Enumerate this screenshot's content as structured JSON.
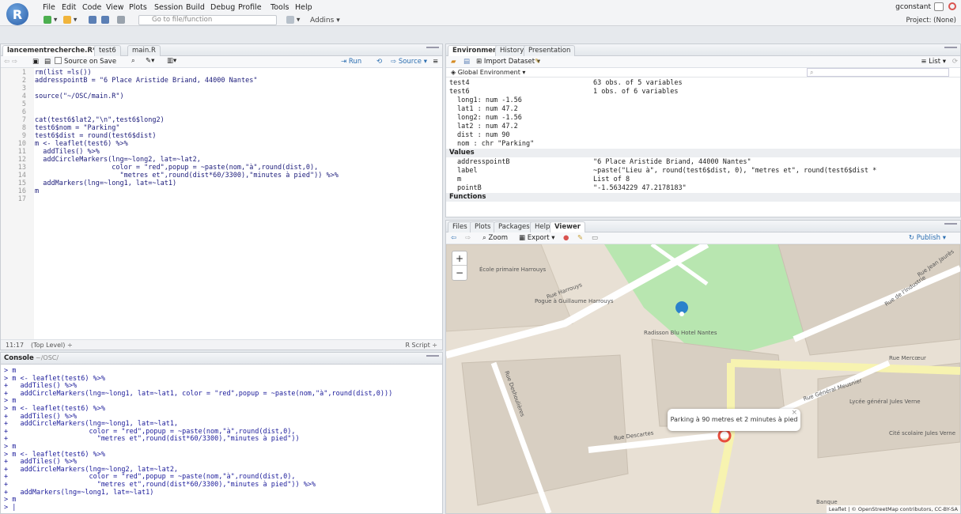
{
  "app": {
    "logo": "R",
    "menu": [
      "File",
      "Edit",
      "Code",
      "View",
      "Plots",
      "Session",
      "Build",
      "Debug",
      "Profile",
      "Tools",
      "Help"
    ],
    "user": "gconstant",
    "goto_placeholder": "Go to file/function",
    "addins": "Addins",
    "project": "Project: (None)"
  },
  "source": {
    "tabs": [
      {
        "label": "lancementrecherche.R*",
        "active": true
      },
      {
        "label": "test6",
        "active": false
      },
      {
        "label": "main.R",
        "active": false
      }
    ],
    "source_on_save": "Source on Save",
    "run": "Run",
    "source_btn": "Source",
    "lines": [
      "rm(list =ls())",
      "addresspointB = \"6 Place Aristide Briand, 44000 Nantes\"",
      "",
      "source(\"~/OSC/main.R\")",
      "",
      "",
      "cat(test6$lat2,\"\\n\",test6$long2)",
      "test6$nom = \"Parking\"",
      "test6$dist = round(test6$dist)",
      "m <- leaflet(test6) %>%",
      "  addTiles() %>%",
      "  addCircleMarkers(lng=~long2, lat=~lat2,",
      "                   color = \"red\",popup = ~paste(nom,\"à\",round(dist,0),",
      "                     \"metres et\",round(dist*60/3300),\"minutes à pied\")) %>%",
      "  addMarkers(lng=~long1, lat=~lat1)",
      "m",
      ""
    ],
    "status_pos": "11:17",
    "status_level": "(Top Level) ÷",
    "status_type": "R Script ÷"
  },
  "console": {
    "title": "Console",
    "path": "~/OSC/",
    "lines": [
      "> m",
      "> m <- leaflet(test6) %>%",
      "+   addTiles() %>%",
      "+   addCircleMarkers(lng=~long1, lat=~lat1, color = \"red\",popup = ~paste(nom,\"à\",round(dist,0)))",
      "> m",
      "> m <- leaflet(test6) %>%",
      "+   addTiles() %>%",
      "+   addCircleMarkers(lng=~long1, lat=~lat1,",
      "+                    color = \"red\",popup = ~paste(nom,\"à\",round(dist,0),",
      "+                      \"metres et\",round(dist*60/3300),\"minutes à pied\"))",
      "> m",
      "> m <- leaflet(test6) %>%",
      "+   addTiles() %>%",
      "+   addCircleMarkers(lng=~long2, lat=~lat2,",
      "+                    color = \"red\",popup = ~paste(nom,\"à\",round(dist,0),",
      "+                      \"metres et\",round(dist*60/3300),\"minutes à pied\")) %>%",
      "+   addMarkers(lng=~long1, lat=~lat1)",
      "> m",
      "> |"
    ]
  },
  "environment": {
    "tabs": [
      "Environment",
      "History",
      "Presentation"
    ],
    "import": "Import Dataset",
    "list": "List",
    "scope": "Global Environment",
    "rows": [
      {
        "name": "test4",
        "value": "63 obs. of 5 variables",
        "kind": "data"
      },
      {
        "name": "test6",
        "value": "1 obs. of 6 variables",
        "kind": "data"
      },
      {
        "name": "  long1: num -1.56",
        "value": "",
        "kind": "sub"
      },
      {
        "name": "  lat1 : num 47.2",
        "value": "",
        "kind": "sub"
      },
      {
        "name": "  long2: num -1.56",
        "value": "",
        "kind": "sub"
      },
      {
        "name": "  lat2 : num 47.2",
        "value": "",
        "kind": "sub"
      },
      {
        "name": "  dist : num 90",
        "value": "",
        "kind": "sub"
      },
      {
        "name": "  nom : chr \"Parking\"",
        "value": "",
        "kind": "sub"
      }
    ],
    "values_header": "Values",
    "values": [
      {
        "name": "addresspointB",
        "value": "\"6 Place Aristide Briand, 44000 Nantes\""
      },
      {
        "name": "label",
        "value": "~paste(\"Lieu à\", round(test6$dist, 0), \"metres et\", round(test6$dist *"
      },
      {
        "name": "m",
        "value": "List of 8"
      },
      {
        "name": "pointB",
        "value": "\"-1.5634229 47.2178183\""
      }
    ],
    "functions_header": "Functions"
  },
  "viewer": {
    "tabs": [
      "Files",
      "Plots",
      "Packages",
      "Help",
      "Viewer"
    ],
    "zoom": "Zoom",
    "export": "Export",
    "publish": "Publish",
    "popup": "Parking à 90 metres et 2 minutes à pied",
    "attribution": "Leaflet | © OpenStreetMap contributors, CC-BY-SA",
    "labels": [
      "École primaire Harrouys",
      "Rue Harrouys",
      "Pogue à Guillaume Harrouys",
      "Radisson Blu Hotel Nantes",
      "Rue Mercœur",
      "Rue Descartes",
      "Rue Général Meusnier",
      "Lycée général Jules Verne",
      "Cité scolaire Jules Verne",
      "Rue de l'Industrie",
      "Rue Jean Jaurès",
      "Rue Deshoulières",
      "Banque"
    ]
  }
}
